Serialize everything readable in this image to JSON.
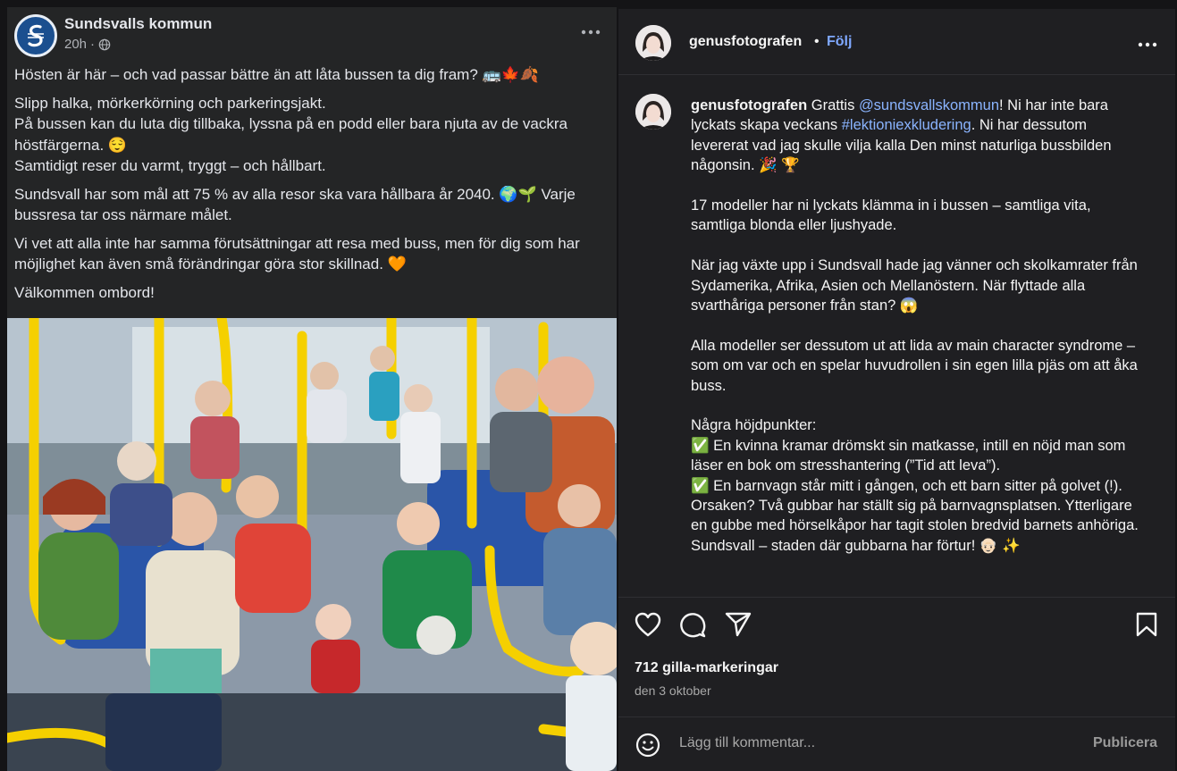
{
  "facebook": {
    "page_name": "Sundsvalls kommun",
    "time": "20h",
    "paragraphs": [
      "Hösten är här – och vad passar bättre än att låta bussen ta dig fram? 🚌🍁🍂",
      "Slipp halka, mörkerkörning och parkeringsjakt.\nPå bussen kan du luta dig tillbaka, lyssna på en podd eller bara njuta av de vackra höstfärgerna. 😌\nSamtidigt reser du varmt, tryggt – och hållbart.",
      "Sundsvall har som mål att 75 % av alla resor ska vara hållbara år 2040. 🌍🌱 Varje bussresa tar oss närmare målet.",
      "Vi vet att alla inte har samma förutsättningar att resa med buss, men för dig som har möjlighet kan även små förändringar göra stor skillnad. 🧡",
      "Välkommen ombord!"
    ],
    "icons": {
      "avatar": "sundsvall-crest-icon",
      "audience": "globe-icon",
      "more": "more-horizontal-icon"
    }
  },
  "instagram": {
    "username": "genusfotografen",
    "separator": "•",
    "follow_label": "Följ",
    "caption": {
      "username": "genusfotografen",
      "intro_before_mention": " Grattis ",
      "mention": "@sundsvallskommun",
      "intro_after_mention": "! Ni har inte bara lyckats skapa veckans ",
      "hashtag": "#lektioniexkludering",
      "intro_end": ". Ni har dessutom levererat vad jag skulle vilja kalla Den minst naturliga bussbilden någonsin. 🎉 🏆",
      "p2": "17 modeller har ni lyckats klämma in i bussen – samtliga vita, samtliga blonda eller ljushyade.",
      "p3": "När jag växte upp i Sundsvall hade jag vänner och skolkamrater från Sydamerika, Afrika, Asien och Mellanöstern. När flyttade alla svarthåriga personer från stan? 😱",
      "p4": "Alla modeller ser dessutom ut att lida av main character syndrome – som om var och en spelar huvudrollen i sin egen lilla pjäs om att åka buss.",
      "p5_heading": "Några höjdpunkter:",
      "p5_item1": "✅ En kvinna kramar drömskt sin matkasse, intill en nöjd man som läser en bok om stresshantering (”Tid att leva”).",
      "p5_item2": "✅ En barnvagn står mitt i gången, och ett barn sitter på golvet (!). Orsaken? Två gubbar har ställt sig på barnvagnsplatsen. Ytterligare en gubbe med hörselkåpor har tagit stolen bredvid barnets anhöriga. Sundsvall – staden där gubbarna har förtur! 👴🏻 ✨"
    },
    "likes": "712 gilla-markeringar",
    "date": "den 3 oktober",
    "comment_placeholder": "Lägg till kommentar...",
    "publish_label": "Publicera",
    "icons": {
      "like": "heart-icon",
      "comment": "comment-icon",
      "share": "send-icon",
      "save": "bookmark-icon",
      "emoji": "emoji-icon",
      "more": "more-horizontal-icon"
    }
  }
}
